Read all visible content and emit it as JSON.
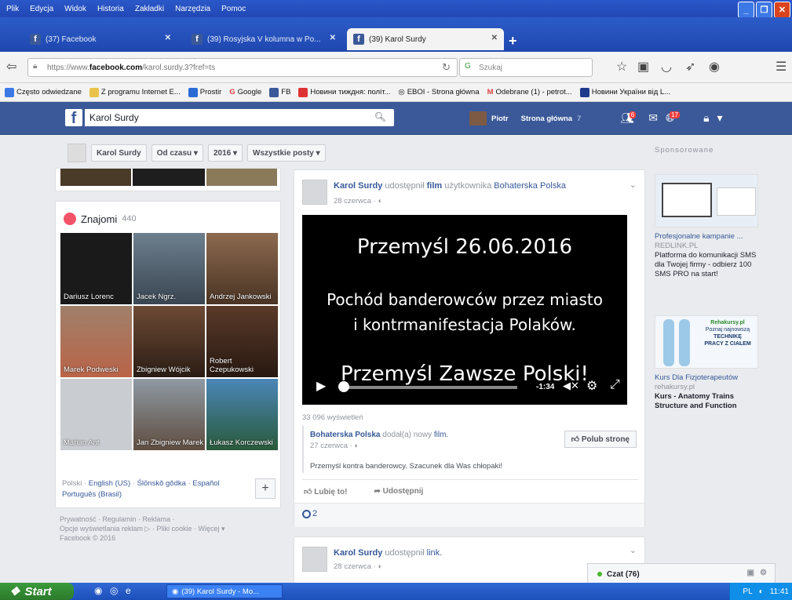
{
  "browser": {
    "menu": [
      "Plik",
      "Edycja",
      "Widok",
      "Historia",
      "Zakładki",
      "Narzędzia",
      "Pomoc"
    ],
    "tabs": [
      {
        "label": "(37) Facebook",
        "active": false
      },
      {
        "label": "(39) Rosyjska V kolumna w Po...",
        "active": false
      },
      {
        "label": "(39) Karol Surdy",
        "active": true
      }
    ],
    "url_prefix": "https://www.",
    "url_domain": "facebook.com",
    "url_path": "/karol.surdy.3?fref=ts",
    "search_placeholder": "Szukaj",
    "bookmarks": [
      "Często odwiedzane",
      "Z programu Internet E...",
      "Prostir",
      "Google",
      "FB",
      "Новини тиждня: полiт...",
      "EBOI - Strona główna",
      "Odebrane (1) - petrot...",
      "Новини України від L..."
    ]
  },
  "fb": {
    "search_value": "Karol Surdy",
    "user_name": "Piotr",
    "home_label": "Strona główna",
    "home_count": "7",
    "notif_counts": [
      "6",
      "17"
    ]
  },
  "filters": {
    "name": "Karol Surdy",
    "time": "Od czasu",
    "year": "2016",
    "posts": "Wszystkie posty"
  },
  "friends": {
    "label": "Znajomi",
    "count": "440",
    "people": [
      "Dariusz Lorenc",
      "Jacek Ngrz.",
      "Andrzej Jankowski",
      "Marek Podweski",
      "Zbigniew Wójcik",
      "Robert Czepukowski",
      "Marian Ant",
      "Jan Zbigniew Marek",
      "Łukasz Korczewski"
    ]
  },
  "languages": {
    "prefix": "Polski",
    "items": [
      "English (US)",
      "Ślōnskŏ gŏdka",
      "Español",
      "Português (Brasil)"
    ]
  },
  "footer": {
    "line1": "Prywatność · Regulamin · Reklama ·",
    "line2": "Opcje wyświetlania reklam ▷ · Pliki cookie · Więcej ▾",
    "line3": "Facebook © 2016"
  },
  "post1": {
    "author": "Karol Surdy",
    "action": "udostępnił",
    "object": "film",
    "suffix": "użytkownika",
    "page": "Bohaterska Polska",
    "date": "28 czerwca · ◐",
    "video_title": "Przemyśl 26.06.2016",
    "video_line1": "Pochód banderowców przez miasto",
    "video_line2": "i kontrmanifestacja Polaków.",
    "video_footer": "Przemyśl Zawsze Polski!",
    "time": "-1:34",
    "views": "33 096 wyświetleń",
    "shared_page": "Bohaterska Polska",
    "shared_action": "dodał(a) nowy",
    "shared_object": "film.",
    "shared_date": "27 czerwca · ◐",
    "like_page": "Polub stronę",
    "caption": "Przemyśl kontra banderowcy. Szacunek dla Was chłopaki!",
    "like": "Lubię to!",
    "share": "Udostępnij",
    "reactions": "2"
  },
  "post2": {
    "author": "Karol Surdy",
    "action": "udostępnił",
    "object": "link.",
    "date": "28 czerwca · ◐"
  },
  "sponsored": {
    "label": "Sponsorowane",
    "ads": [
      {
        "title": "Profesjonalne kampanie ...",
        "url": "REDLINK.PL",
        "text": "Platforma do komunikacji SMS dla Twojej firmy - odbierz 100 SMS PRO na start!"
      },
      {
        "title": "Kurs Dla Fizjoterapeutów",
        "url": "rehakursy.pl",
        "text": "Kurs - Anatomy Trains Structure and Function",
        "img_lines": [
          "Rehakursy.pl",
          "Poznaj najnowszą",
          "TECHNIKĘ",
          "PRACY Z CIAŁEM"
        ]
      }
    ]
  },
  "chat": {
    "label": "Czat (76)"
  },
  "taskbar": {
    "start": "Start",
    "task": "(39) Karol Surdy - Mo...",
    "lang": "PL",
    "clock": "11:41"
  },
  "colors": {
    "fb_blue": "#3b5998",
    "link": "#365899",
    "xp_blue": "#2148b5",
    "start_green": "#2b7a2b"
  }
}
